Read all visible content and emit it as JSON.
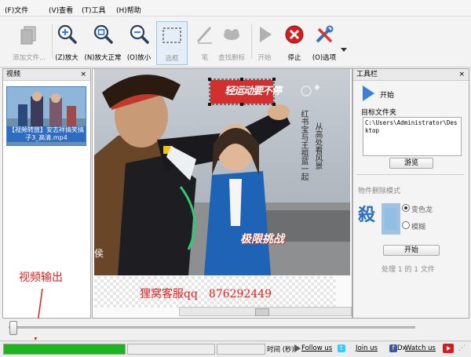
{
  "menu": {
    "file": "(F)文件",
    "view": "(V)查看",
    "tools": "(T)工具",
    "help": "(H)帮助"
  },
  "toolbar": {
    "add_file": "添加文件...",
    "zoom_in": "(Z)放大",
    "zoom_normal": "(N)放大正常",
    "zoom_out": "(O)放小",
    "select": "选框",
    "pen": "笔",
    "find_remove": "查找删标",
    "start": "开始",
    "stop": "停止",
    "options": "(O)选项"
  },
  "left_panel": {
    "title": "视频",
    "close_glyph": "×",
    "file_name": "【视频转放】安志祥搞笑搞子3_高清.mp4"
  },
  "preview": {
    "sticker_text": "轻运动要不停",
    "caption_line1": "红书宝与王祖蓝一起",
    "caption_line2": "从高处看风景",
    "caption_left": "侯",
    "show_logo": "极限挑战",
    "watermark_text": "狸窝客服qq　876292449"
  },
  "annotation": {
    "label": "视频输出",
    "color": "#e02020"
  },
  "right_panel": {
    "title": "工具栏",
    "close_glyph": "×",
    "start_label": "开始",
    "target_folder_label": "目标文件夹",
    "target_folder_value": "C:\\Users\\Administrator\\Desktop",
    "browse_button": "游览",
    "remove_mode_label": "物件删除模式",
    "mode_option_1": "变色龙",
    "mode_option_2": "模糊",
    "start_button": "开始",
    "progress_text": "处理 1 的 1 文件"
  },
  "status": {
    "time_label": "时间 (秒):",
    "follow_us": "Follow us",
    "join_us": "Join us",
    "watch_us": "Watch us",
    "fb_glyph": "f",
    "fb_after": "Dx",
    "progress_fraction": 1.0
  },
  "colors": {
    "accent": "#3a7fd5",
    "progress": "#1db51d",
    "stop_red": "#d21e1e",
    "watermark_red": "#e02020"
  }
}
